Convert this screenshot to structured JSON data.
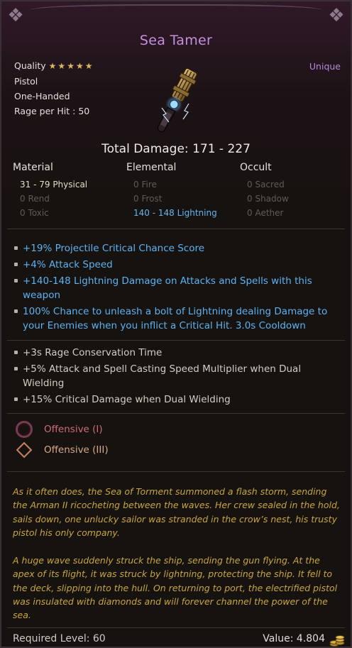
{
  "item": {
    "name": "Sea Tamer",
    "quality_label": "Quality",
    "quality_stars": "★★★★★",
    "rarity": "Unique",
    "type": "Pistol",
    "handedness": "One-Handed",
    "rage_per_hit": "Rage per Hit : 50",
    "total_damage": "Total Damage: 171 - 227"
  },
  "damage": {
    "material": {
      "header": "Material",
      "rows": [
        "31 - 79  Physical",
        "0  Rend",
        "0  Toxic"
      ]
    },
    "elemental": {
      "header": "Elemental",
      "rows": [
        "0  Fire",
        "0  Frost",
        "140 - 148  Lightning"
      ]
    },
    "occult": {
      "header": "Occult",
      "rows": [
        "0  Sacred",
        "0  Shadow",
        "0  Aether"
      ]
    }
  },
  "blue_mods": [
    "+19% Projectile Critical Chance Score",
    "+4% Attack Speed",
    "+140-148 Lightning Damage on Attacks and Spells with this weapon",
    "100% Chance to unleash a bolt of Lightning dealing Damage to your Enemies when you inflict a Critical Hit. 3.0s Cooldown"
  ],
  "grey_mods": [
    "+3s Rage Conservation Time",
    "+5% Attack and Spell Casting Speed Multiplier when Dual Wielding",
    "+15% Critical Damage when Dual Wielding"
  ],
  "sockets": [
    {
      "label": "Offensive (I)",
      "icon": "ring-socket-icon"
    },
    {
      "label": "Offensive (III)",
      "icon": "diamond-socket-icon"
    }
  ],
  "lore": [
    "As it often does, the Sea of Torment summoned a flash storm, sending the Arman II ricocheting between the waves. Her crew sealed in the hold, sails down, one unlucky sailor was stranded in the crow’s nest, his trusty pistol his only company.",
    "A huge wave suddenly struck the ship, sending the gun flying. At the apex of its flight, it was struck by lightning, protecting the ship. It fell to the deck, slipping into the hull. On returning to port, the electrified pistol was insulated with diamonds and will forever channel the power of the sea."
  ],
  "footer": {
    "required_level": "Required Level: 60",
    "value": "Value: 4.804"
  },
  "colors": {
    "title": "#c58fe0",
    "rarity": "#b98ad9",
    "blue_mod": "#5cb2f2",
    "lore": "#c9a63e"
  }
}
